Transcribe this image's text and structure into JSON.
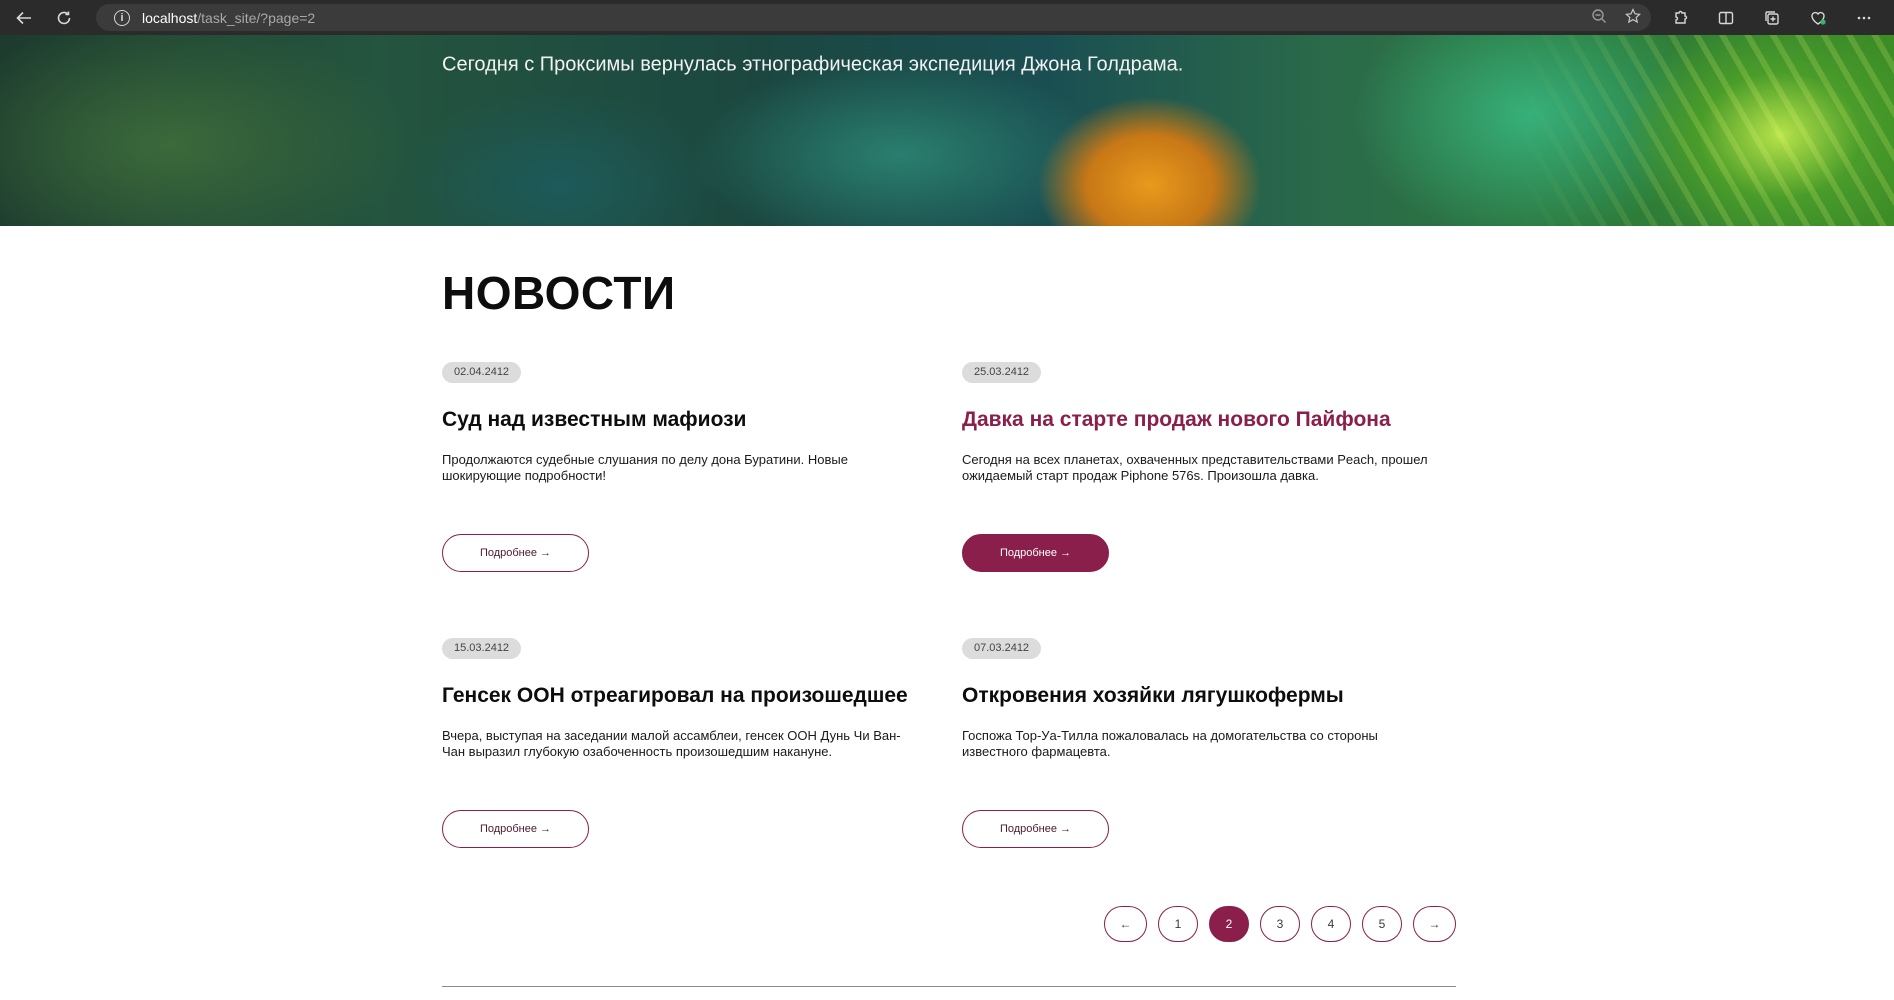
{
  "browser": {
    "url_host": "localhost",
    "url_path": "/task_site/?page=2",
    "icons": [
      "back-icon",
      "reload-icon",
      "info-icon",
      "zoom-out-icon",
      "favorite-star-icon",
      "extensions-icon",
      "split-screen-icon",
      "collections-icon",
      "copilot-icon",
      "more-icon"
    ]
  },
  "hero": {
    "text": "Сегодня с Проксимы вернулась этнографическая экспедиция Джона Голдрама."
  },
  "news": {
    "title": "НОВОСТИ",
    "items": [
      {
        "date": "02.04.2412",
        "title": "Суд над известным мафиози",
        "text": "Продолжаются судебные слушания по делу дона Буратини. Новые шокирующие подробности!",
        "more": "Подробнее →"
      },
      {
        "date": "25.03.2412",
        "title": "Давка на старте продаж нового Пайфона",
        "text": "Сегодня на всех планетах, охваченных представительствами Peach, прошел ожидаемый старт продаж Piphone 576s. Произошла давка.",
        "more": "Подробнее →"
      },
      {
        "date": "15.03.2412",
        "title": "Генсек ООН отреагировал на произошедшее",
        "text": "Вчера, выступая на заседании малой ассамблеи, генсек ООН Дунь Чи Ван-Чан выразил глубокую озабоченность произошедшим накануне.",
        "more": "Подробнее →"
      },
      {
        "date": "07.03.2412",
        "title": "Откровения хозяйки лягушкофермы",
        "text": "Госпожа Тор-Уа-Тилла пожаловалась на домогательства со стороны известного фармацевта.",
        "more": "Подробнее →"
      }
    ]
  },
  "pagination": {
    "prev": "←",
    "pages": [
      "1",
      "2",
      "3",
      "4",
      "5"
    ],
    "current": "2",
    "next": "→"
  },
  "colors": {
    "accent": "#8a1f4b",
    "badge_bg": "#dcdcdc"
  }
}
